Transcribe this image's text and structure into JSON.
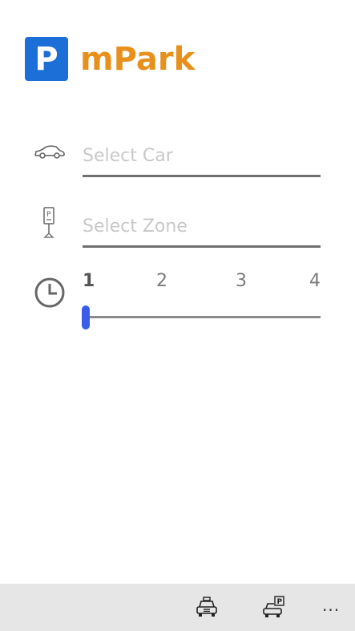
{
  "app": {
    "logo_letter": "P",
    "title": "mPark",
    "logo_color": "#1b6fd6",
    "title_color": "#e8901c"
  },
  "form": {
    "car": {
      "icon": "car-icon",
      "placeholder": "Select Car"
    },
    "zone": {
      "icon": "parking-meter-icon",
      "placeholder": "Select Zone"
    },
    "duration": {
      "icon": "clock-icon",
      "ticks": [
        "1",
        "2",
        "3",
        "4"
      ],
      "selected": "1",
      "accent_color": "#3a5de8"
    }
  },
  "appbar": {
    "buttons": [
      {
        "icon": "taxi-icon"
      },
      {
        "icon": "car-parking-icon"
      }
    ],
    "more_label": "..."
  }
}
